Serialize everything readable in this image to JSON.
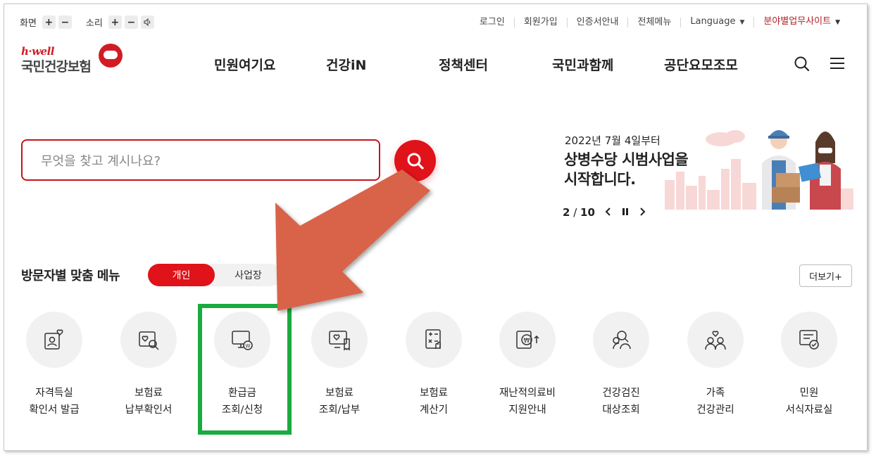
{
  "util": {
    "screen_label": "화면",
    "sound_label": "소리",
    "plus": "+",
    "minus": "−",
    "links": [
      "로그인",
      "회원가입",
      "인증서안내",
      "전체메뉴"
    ],
    "language": "Language",
    "field_sites": "분야별업무사이트"
  },
  "logo": {
    "hwell": "h·well",
    "name": "국민건강보험"
  },
  "gnb": {
    "items": [
      "민원여기요",
      "건강iN",
      "정책센터",
      "국민과함께",
      "공단요모조모"
    ]
  },
  "search": {
    "placeholder": "무엇을 찾고 계시나요?"
  },
  "banner": {
    "date": "2022년 7월 4일부터",
    "title_line1": "상병수당 시범사업을",
    "title_line2": "시작합니다.",
    "page_current": "2",
    "page_total": "10",
    "page_sep": " / "
  },
  "visitor_menu": {
    "title": "방문자별 맞춤 메뉴",
    "tab_personal": "개인",
    "tab_business": "사업장",
    "more": "더보기+",
    "items": [
      {
        "line1": "자격득실",
        "line2": "확인서 발급",
        "icon": "id-card-heart-icon"
      },
      {
        "line1": "보험료",
        "line2": "납부확인서",
        "icon": "document-search-icon"
      },
      {
        "line1": "환급금",
        "line2": "조회/신청",
        "icon": "monitor-won-icon"
      },
      {
        "line1": "보험료",
        "line2": "조회/납부",
        "icon": "monitor-receipt-icon"
      },
      {
        "line1": "보험료",
        "line2": "계산기",
        "icon": "calculator-hand-icon"
      },
      {
        "line1": "재난적의료비",
        "line2": "지원안내",
        "icon": "won-wallet-icon"
      },
      {
        "line1": "건강검진",
        "line2": "대상조회",
        "icon": "people-search-icon"
      },
      {
        "line1": "가족",
        "line2": "건강관리",
        "icon": "family-heart-icon"
      },
      {
        "line1": "민원",
        "line2": "서식자료실",
        "icon": "form-check-icon"
      }
    ]
  },
  "colors": {
    "accent": "#e0121a",
    "highlight": "#1aab3f",
    "arrow": "#d9644a"
  }
}
